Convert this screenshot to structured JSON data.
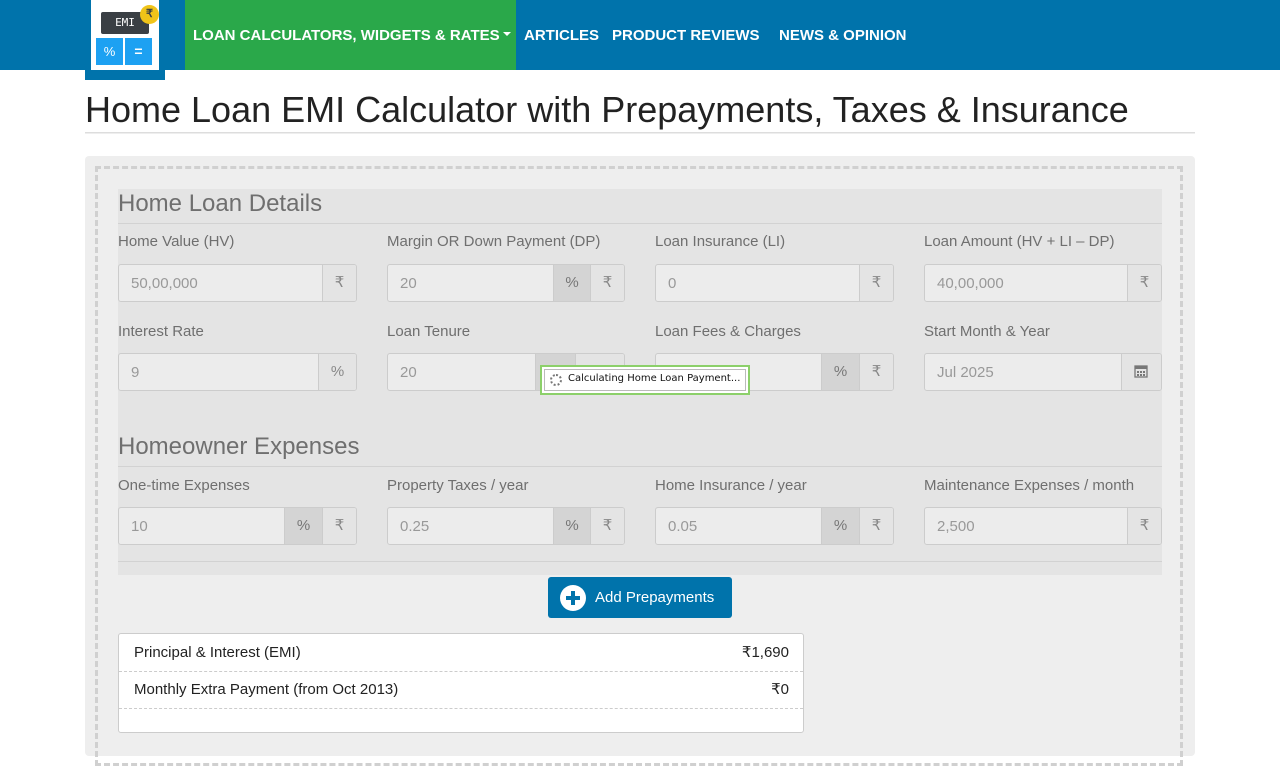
{
  "logo": {
    "screen_text": "EMI",
    "coin": "₹",
    "key1": "%",
    "key2": "="
  },
  "nav": {
    "items": [
      "LOAN CALCULATORS, WIDGETS & RATES",
      "ARTICLES",
      "PRODUCT REVIEWS",
      "NEWS & OPINION"
    ]
  },
  "page": {
    "title": "Home Loan EMI Calculator with Prepayments, Taxes & Insurance"
  },
  "loan_details": {
    "heading": "Home Loan Details",
    "home_value": {
      "label": "Home Value (HV)",
      "value": "50,00,000",
      "unit": "₹"
    },
    "down_payment": {
      "label": "Margin OR Down Payment (DP)",
      "value": "20",
      "unit_pct": "%",
      "unit_rs": "₹"
    },
    "loan_insurance": {
      "label": "Loan Insurance (LI)",
      "value": "0",
      "unit": "₹"
    },
    "loan_amount": {
      "label": "Loan Amount (HV + LI – DP)",
      "value": "40,00,000",
      "unit": "₹"
    },
    "interest_rate": {
      "label": "Interest Rate",
      "value": "9",
      "unit": "%"
    },
    "loan_tenure": {
      "label": "Loan Tenure",
      "value": "20"
    },
    "loan_fees": {
      "label": "Loan Fees & Charges",
      "unit_pct": "%",
      "unit_rs": "₹"
    },
    "start_month": {
      "label": "Start Month & Year",
      "value": "Jul 2025"
    }
  },
  "loading": {
    "text": "Calculating Home Loan Payment..."
  },
  "expenses": {
    "heading": "Homeowner Expenses",
    "one_time": {
      "label": "One-time Expenses",
      "value": "10",
      "unit_pct": "%",
      "unit_rs": "₹"
    },
    "property_taxes": {
      "label": "Property Taxes / year",
      "value": "0.25",
      "unit_pct": "%",
      "unit_rs": "₹"
    },
    "home_insurance": {
      "label": "Home Insurance / year",
      "value": "0.05",
      "unit_pct": "%",
      "unit_rs": "₹"
    },
    "maintenance": {
      "label": "Maintenance Expenses / month",
      "value": "2,500",
      "unit": "₹"
    }
  },
  "prepay_button": {
    "label": "Add Prepayments"
  },
  "summary": [
    {
      "label": "Principal & Interest (EMI)",
      "value": "₹1,690"
    },
    {
      "label": "Monthly Extra Payment (from Oct 2013)",
      "value": "₹0"
    }
  ]
}
